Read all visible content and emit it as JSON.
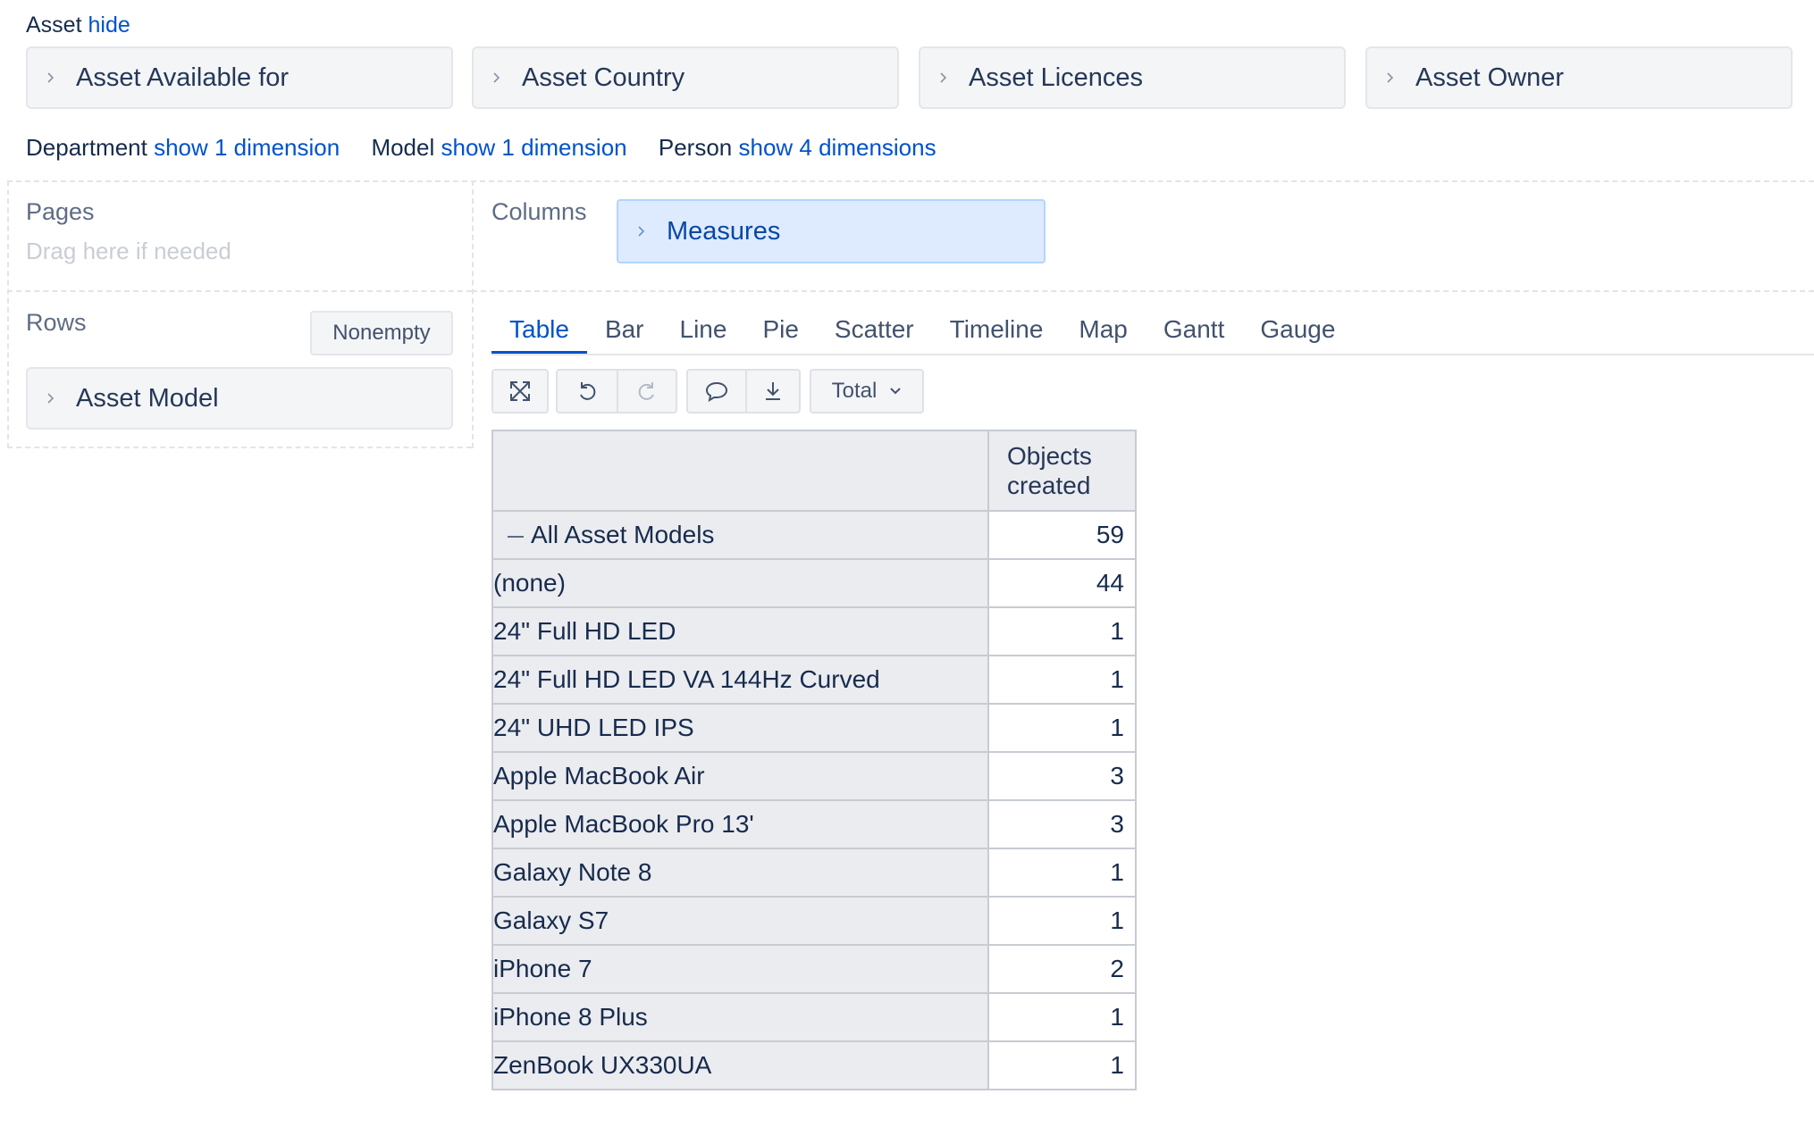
{
  "asset": {
    "label": "Asset",
    "hide_link": "hide",
    "dimensions": [
      "Asset Available for",
      "Asset Country",
      "Asset Licences",
      "Asset Owner"
    ]
  },
  "other_dimensions": [
    {
      "label": "Department",
      "link": "show 1 dimension"
    },
    {
      "label": "Model",
      "link": "show 1 dimension"
    },
    {
      "label": "Person",
      "link": "show 4 dimensions"
    }
  ],
  "pages": {
    "title": "Pages",
    "placeholder": "Drag here if needed"
  },
  "columns": {
    "title": "Columns",
    "dimension": "Measures"
  },
  "rows": {
    "title": "Rows",
    "nonempty_label": "Nonempty",
    "dimension": "Asset Model"
  },
  "tabs": [
    "Table",
    "Bar",
    "Line",
    "Pie",
    "Scatter",
    "Timeline",
    "Map",
    "Gantt",
    "Gauge"
  ],
  "active_tab": "Table",
  "toolbar": {
    "icons": [
      "expand-icon",
      "undo-icon",
      "redo-icon",
      "comment-icon",
      "download-icon"
    ],
    "total_label": "Total"
  },
  "table": {
    "column_header": [
      "Objects",
      "created"
    ],
    "rows": [
      {
        "label": "All Asset Models",
        "value": "59",
        "level": 0,
        "expanded": true
      },
      {
        "label": "(none)",
        "value": "44",
        "level": 1
      },
      {
        "label": "24\" Full HD LED",
        "value": "1",
        "level": 1
      },
      {
        "label": "24\" Full HD LED VA 144Hz Curved",
        "value": "1",
        "level": 1
      },
      {
        "label": "24\" UHD LED IPS",
        "value": "1",
        "level": 1
      },
      {
        "label": "Apple MacBook Air",
        "value": "3",
        "level": 1
      },
      {
        "label": "Apple MacBook Pro 13'",
        "value": "3",
        "level": 1
      },
      {
        "label": "Galaxy Note 8",
        "value": "1",
        "level": 1
      },
      {
        "label": "Galaxy S7",
        "value": "1",
        "level": 1
      },
      {
        "label": "iPhone 7",
        "value": "2",
        "level": 1
      },
      {
        "label": "iPhone 8 Plus",
        "value": "1",
        "level": 1
      },
      {
        "label": "ZenBook UX330UA",
        "value": "1",
        "level": 1
      }
    ]
  },
  "colors": {
    "link": "#0052cc",
    "measures_bg": "#deebff",
    "header_bg": "#ebecf0"
  }
}
